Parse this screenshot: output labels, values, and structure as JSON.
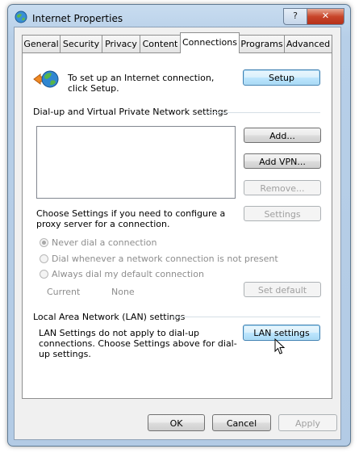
{
  "window": {
    "title": "Internet Properties",
    "help_label": "?",
    "close_label": "✕"
  },
  "tabs": [
    {
      "label": "General"
    },
    {
      "label": "Security"
    },
    {
      "label": "Privacy"
    },
    {
      "label": "Content"
    },
    {
      "label": "Connections",
      "active": true
    },
    {
      "label": "Programs"
    },
    {
      "label": "Advanced"
    }
  ],
  "setup": {
    "text": "To set up an Internet connection, click Setup.",
    "button": "Setup"
  },
  "dialup": {
    "heading": "Dial-up and Virtual Private Network settings",
    "add_button": "Add...",
    "add_vpn_button": "Add VPN...",
    "remove_button": "Remove...",
    "settings_text": "Choose Settings if you need to configure a proxy server for a connection.",
    "settings_button": "Settings",
    "radios": [
      {
        "label": "Never dial a connection",
        "checked": true
      },
      {
        "label": "Dial whenever a network connection is not present",
        "checked": false
      },
      {
        "label": "Always dial my default connection",
        "checked": false
      }
    ],
    "current_label": "Current",
    "current_value": "None",
    "set_default_button": "Set default"
  },
  "lan": {
    "heading": "Local Area Network (LAN) settings",
    "text": "LAN Settings do not apply to dial-up connections. Choose Settings above for dial-up settings.",
    "button": "LAN settings"
  },
  "footer": {
    "ok": "OK",
    "cancel": "Cancel",
    "apply": "Apply"
  }
}
